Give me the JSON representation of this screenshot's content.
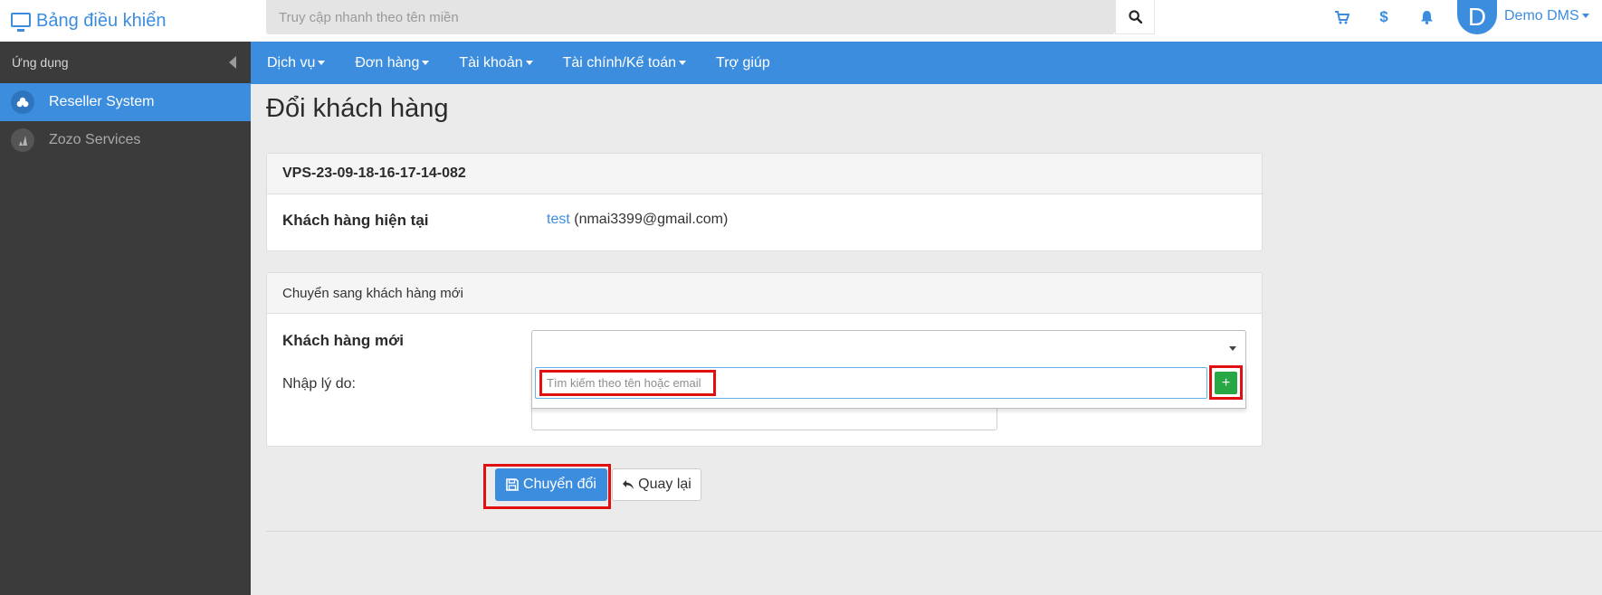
{
  "header": {
    "brand": "Bảng điều khiển",
    "search_placeholder": "Truy cập nhanh theo tên miền",
    "user_initial": "D",
    "user_name": "Demo DMS"
  },
  "sidebar": {
    "title": "Ứng dụng",
    "items": [
      {
        "label": "Reseller System",
        "active": true
      },
      {
        "label": "Zozo Services",
        "active": false
      }
    ]
  },
  "navbar": {
    "items": [
      "Dịch vụ",
      "Đơn hàng",
      "Tài khoản",
      "Tài chính/Kế toán",
      "Trợ giúp"
    ]
  },
  "page": {
    "title": "Đổi khách hàng",
    "service_panel": {
      "service_id": "VPS-23-09-18-16-17-14-082",
      "current_customer_label": "Khách hàng hiện tại",
      "current_customer_name": "test",
      "current_customer_email": "(nmai3399@gmail.com)"
    },
    "transfer_panel": {
      "title": "Chuyển sang khách hàng mới",
      "new_customer_label": "Khách hàng mới",
      "reason_label": "Nhập lý do:",
      "search_placeholder": "Tìm kiếm theo tên hoặc email",
      "add_label": "+"
    },
    "buttons": {
      "submit": "Chuyển đổi",
      "back": "Quay lại"
    }
  },
  "colors": {
    "accent": "#3c8dde",
    "sidebar_bg": "#3b3b3b",
    "success": "#28a745",
    "highlight": "#e01010"
  }
}
